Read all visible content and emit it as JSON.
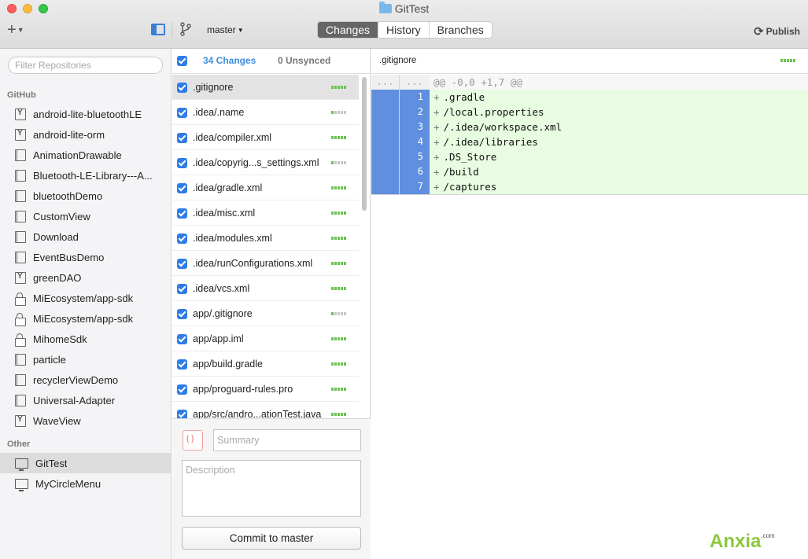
{
  "window": {
    "title": "GitTest"
  },
  "toolbar": {
    "add_label": "+",
    "branch": "master",
    "tabs": [
      "Changes",
      "History",
      "Branches"
    ],
    "active_tab": "Changes",
    "publish_label": "Publish"
  },
  "sidebar": {
    "filter_placeholder": "Filter Repositories",
    "github_label": "GitHub",
    "github_repos": [
      {
        "label": "android-lite-bluetoothLE",
        "icon": "fork-icon"
      },
      {
        "label": "android-lite-orm",
        "icon": "fork-icon"
      },
      {
        "label": "AnimationDrawable",
        "icon": "repo-icon"
      },
      {
        "label": "Bluetooth-LE-Library---A...",
        "icon": "repo-icon"
      },
      {
        "label": "bluetoothDemo",
        "icon": "repo-icon"
      },
      {
        "label": "CustomView",
        "icon": "repo-icon"
      },
      {
        "label": "Download",
        "icon": "repo-icon"
      },
      {
        "label": "EventBusDemo",
        "icon": "repo-icon"
      },
      {
        "label": "greenDAO",
        "icon": "fork-icon"
      },
      {
        "label": "MiEcosystem/app-sdk",
        "icon": "lock-icon"
      },
      {
        "label": "MiEcosystem/app-sdk",
        "icon": "lock-icon"
      },
      {
        "label": "MihomeSdk",
        "icon": "lock-icon"
      },
      {
        "label": "particle",
        "icon": "repo-icon"
      },
      {
        "label": "recyclerViewDemo",
        "icon": "repo-icon"
      },
      {
        "label": "Universal-Adapter",
        "icon": "repo-icon"
      },
      {
        "label": "WaveView",
        "icon": "fork-icon"
      }
    ],
    "other_label": "Other",
    "other_repos": [
      {
        "label": "GitTest",
        "icon": "monitor-icon",
        "selected": true
      },
      {
        "label": "MyCircleMenu",
        "icon": "monitor-icon"
      }
    ]
  },
  "changes": {
    "count_label": "34 Changes",
    "unsynced_label": "0 Unsynced",
    "files": [
      {
        "name": ".gitignore",
        "stat": "aaaaa"
      },
      {
        "name": ".idea/.name",
        "stat": "agggg"
      },
      {
        "name": ".idea/compiler.xml",
        "stat": "aaaaa"
      },
      {
        "name": ".idea/copyrig...s_settings.xml",
        "stat": "agggg"
      },
      {
        "name": ".idea/gradle.xml",
        "stat": "aaaaa"
      },
      {
        "name": ".idea/misc.xml",
        "stat": "aaaaa"
      },
      {
        "name": ".idea/modules.xml",
        "stat": "aaaaa"
      },
      {
        "name": ".idea/runConfigurations.xml",
        "stat": "aaaaa"
      },
      {
        "name": ".idea/vcs.xml",
        "stat": "aaaaa"
      },
      {
        "name": "app/.gitignore",
        "stat": "agggg"
      },
      {
        "name": "app/app.iml",
        "stat": "aaaaa"
      },
      {
        "name": "app/build.gradle",
        "stat": "aaaaa"
      },
      {
        "name": "app/proguard-rules.pro",
        "stat": "aaaaa"
      },
      {
        "name": "app/src/andro...ationTest.java",
        "stat": "aaaaa"
      }
    ],
    "summary_placeholder": "Summary",
    "description_placeholder": "Description",
    "commit_label": "Commit to master"
  },
  "diff": {
    "file_name": ".gitignore",
    "hunk": {
      "g1": "...",
      "g2": "...",
      "text": "@@ -0,0 +1,7 @@"
    },
    "lines": [
      {
        "num": "1",
        "text": ".gradle"
      },
      {
        "num": "2",
        "text": "/local.properties"
      },
      {
        "num": "3",
        "text": "/.idea/workspace.xml"
      },
      {
        "num": "4",
        "text": "/.idea/libraries"
      },
      {
        "num": "5",
        "text": ".DS_Store"
      },
      {
        "num": "6",
        "text": "/build"
      },
      {
        "num": "7",
        "text": "/captures"
      }
    ]
  },
  "watermark": {
    "text": "Anxia",
    "suffix": ".com"
  },
  "colors": {
    "accent": "#2f7ce8",
    "added": "#e7fce0",
    "gutter": "#5f8fde",
    "stat_add": "#6ac34f"
  }
}
